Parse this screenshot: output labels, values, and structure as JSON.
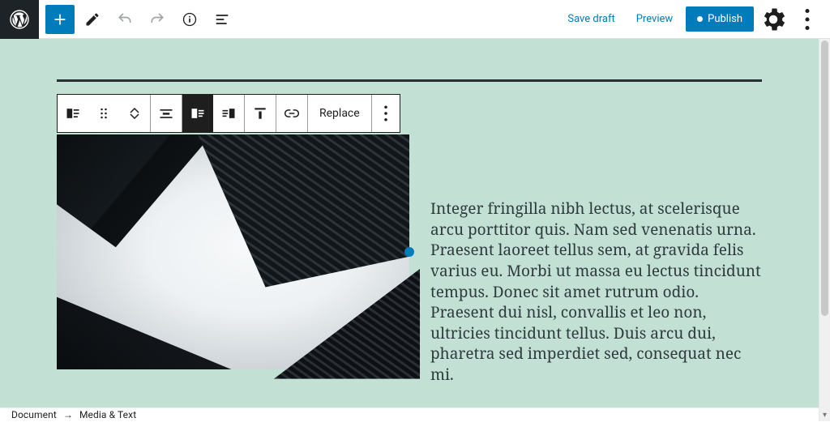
{
  "topbar": {
    "save_draft": "Save draft",
    "preview": "Preview",
    "publish": "Publish"
  },
  "blockToolbar": {
    "replace": "Replace"
  },
  "breadcrumb": {
    "level1": "Document",
    "sep": "→",
    "level2": "Media & Text"
  },
  "content": {
    "paragraph": "Integer fringilla nibh lectus, at scelerisque arcu porttitor quis. Nam sed venenatis urna. Praesent laoreet tellus sem, at gravida felis varius eu. Morbi ut massa eu lectus tincidunt tempus. Donec sit amet rutrum odio. Praesent dui nisl, convallis et leo non, ultricies tincidunt tellus. Duis arcu dui, pharetra sed imperdiet sed, consequat nec mi."
  }
}
